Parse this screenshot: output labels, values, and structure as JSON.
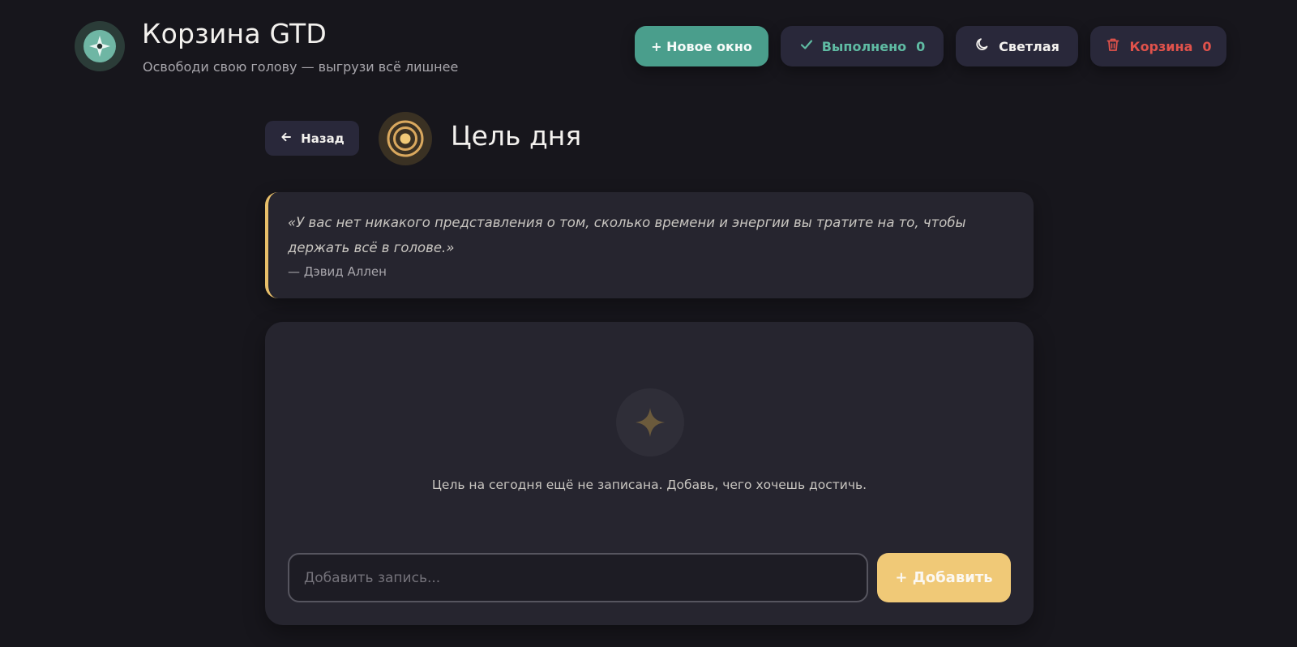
{
  "header": {
    "title": "Корзина GTD",
    "subtitle": "Освободи свою голову — выгрузи всё лишнее",
    "logo_icon": "compass-icon"
  },
  "toolbar": {
    "new_window_label": "+ Новое окно",
    "done_label": "Выполнено",
    "done_count": "0",
    "theme_label": "Светлая",
    "trash_label": "Корзина",
    "trash_count": "0"
  },
  "page": {
    "back_label": "Назад",
    "title": "Цель дня",
    "title_icon": "target-icon"
  },
  "quote": {
    "text": "«У вас нет никакого представления о том, сколько времени и энергии вы тратите на то, чтобы держать всё в голове.»",
    "author": "— Дэвид Аллен"
  },
  "empty_state": {
    "icon": "sparkle-icon",
    "text": "Цель на сегодня ещё не записана. Добавь, чего хочешь достичь."
  },
  "entry": {
    "placeholder": "Добавить запись...",
    "value": "",
    "add_label": "+ Добавить"
  },
  "colors": {
    "background": "#17161c",
    "card": "#26252f",
    "accent_teal": "#4a9e8c",
    "accent_gold": "#f0c977",
    "danger": "#e0524b"
  }
}
